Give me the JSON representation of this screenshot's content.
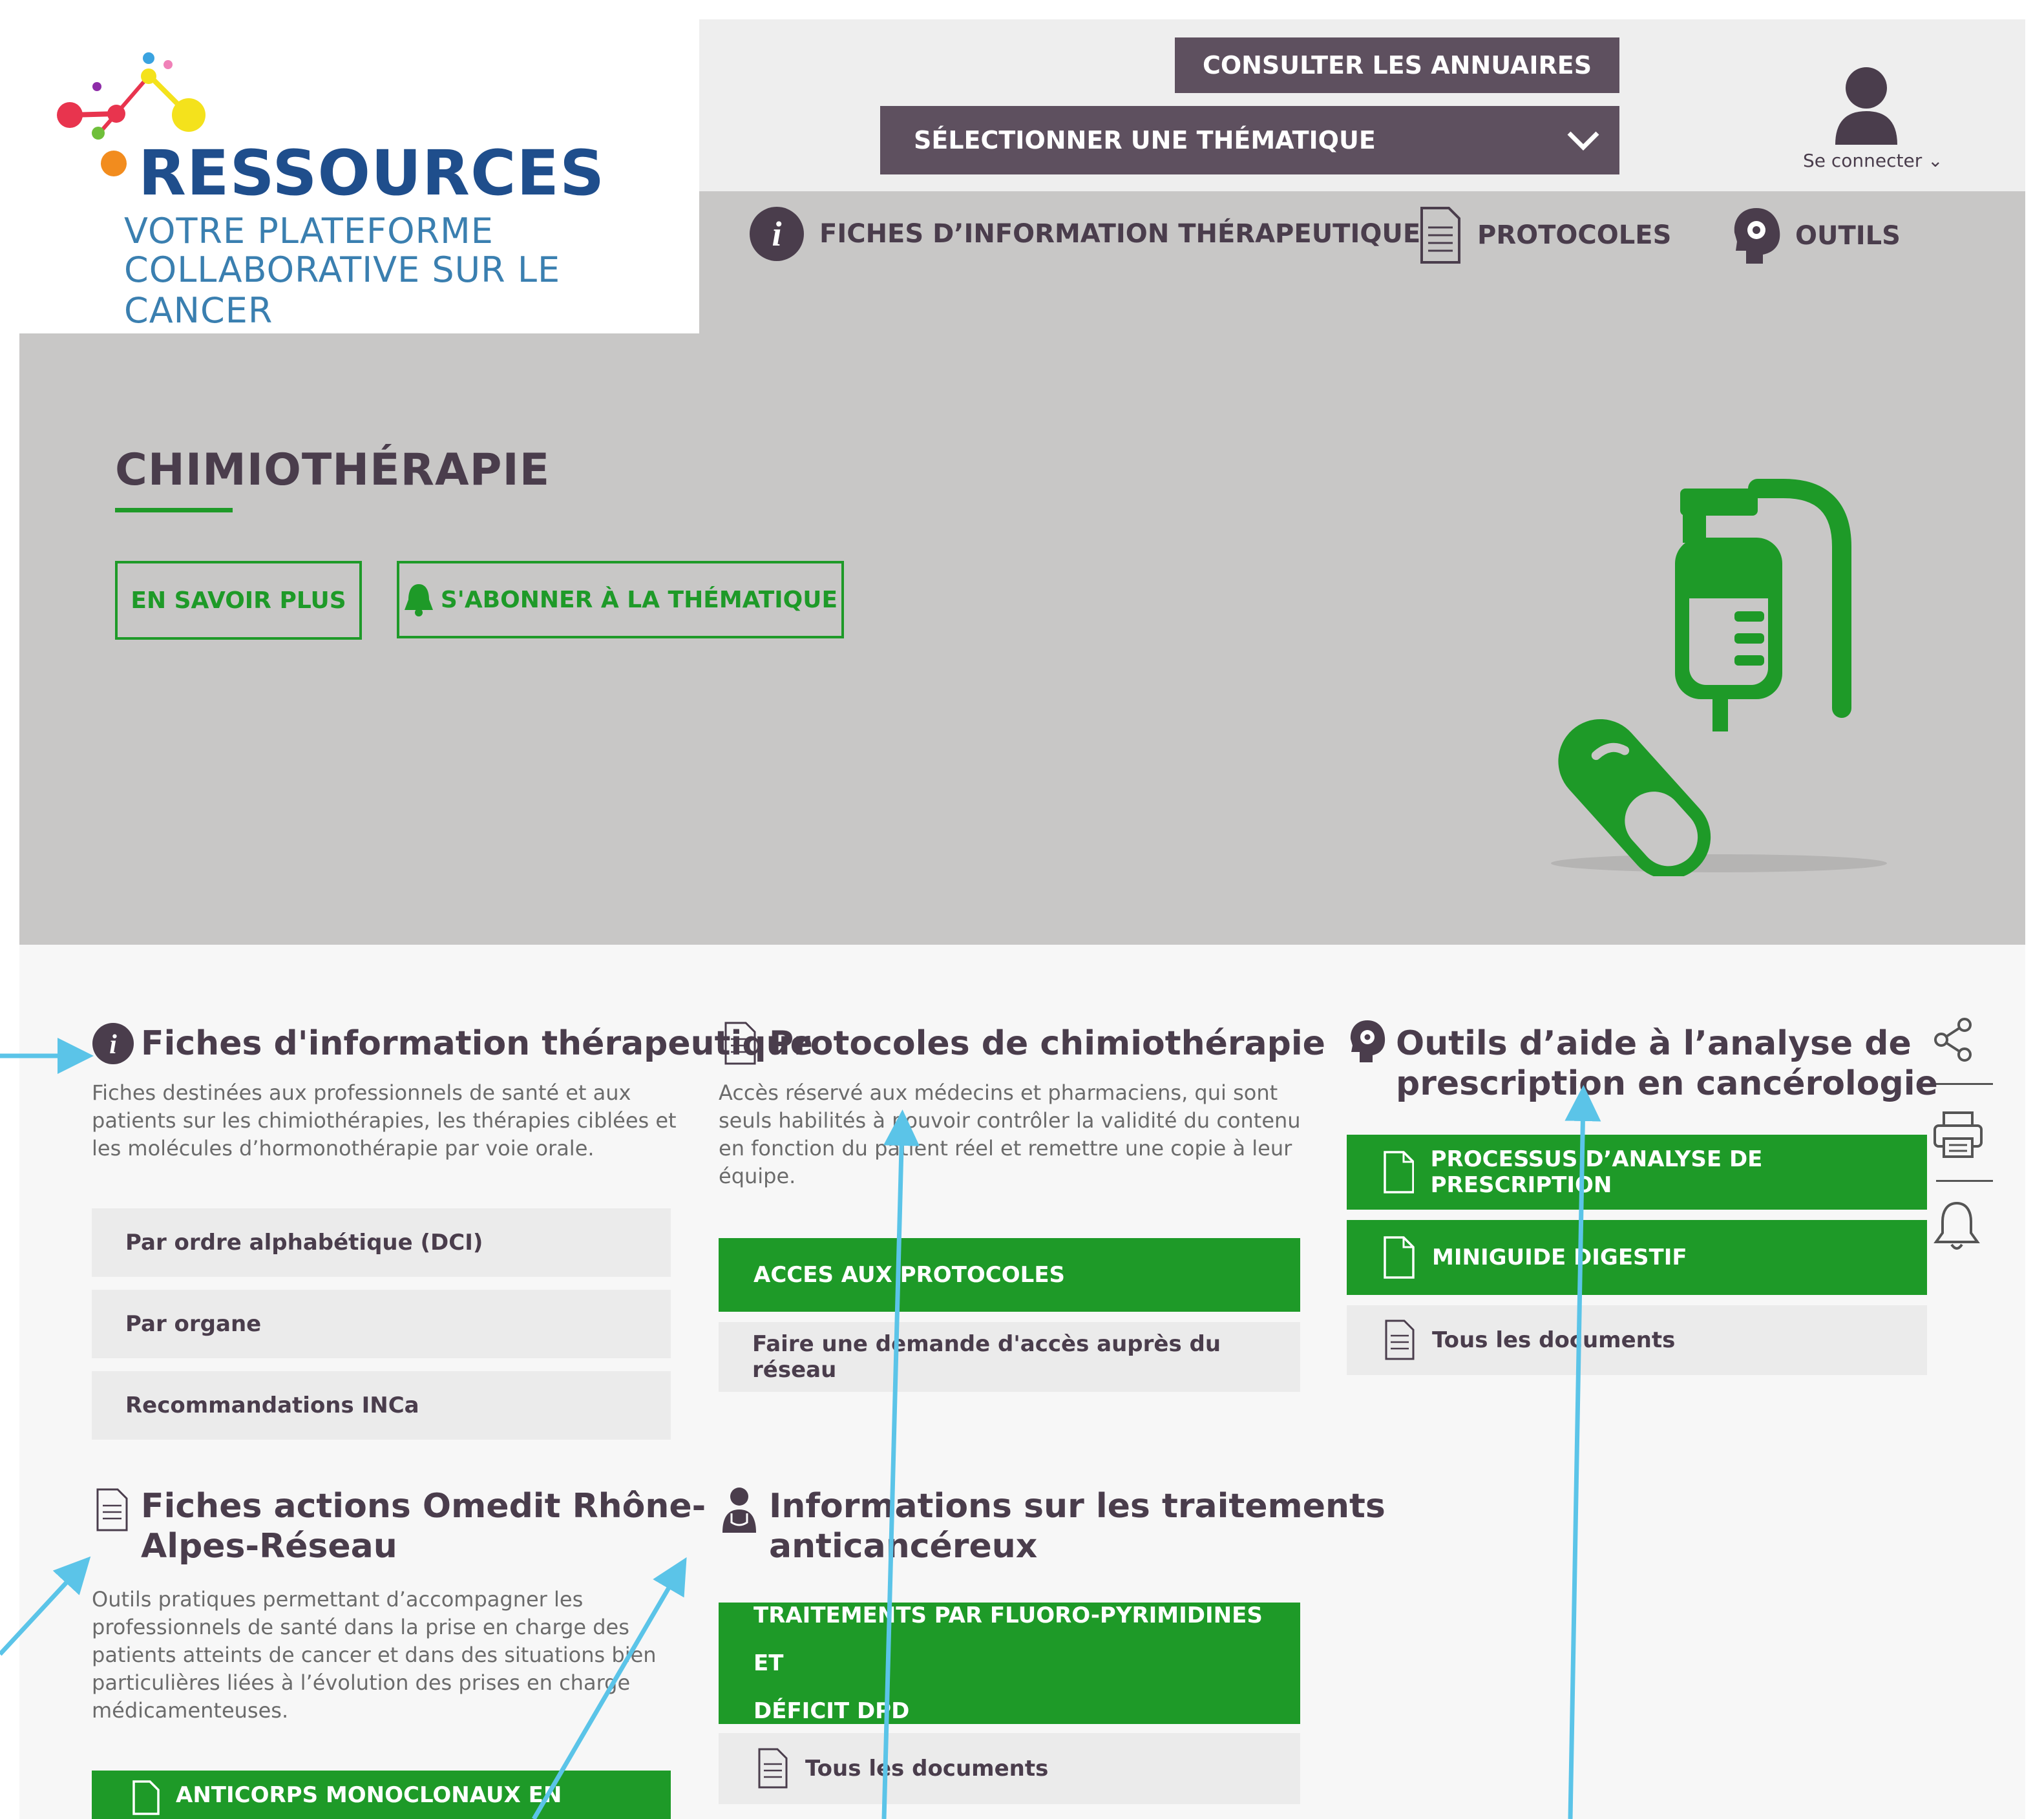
{
  "logo": {
    "name": "RESSOURCES",
    "tagline_1": "VOTRE PLATEFORME",
    "tagline_2": "COLLABORATIVE SUR LE CANCER"
  },
  "header": {
    "annuaires_label": "CONSULTER LES ANNUAIRES",
    "thematique_select": "SÉLECTIONNER UNE THÉMATIQUE",
    "login_label": "Se connecter",
    "nav": [
      {
        "label": "FICHES D’INFORMATION THÉRAPEUTIQUE",
        "icon": "info-icon"
      },
      {
        "label": "PROTOCOLES",
        "icon": "document-icon"
      },
      {
        "label": "OUTILS",
        "icon": "brain-gear-icon"
      }
    ]
  },
  "hero": {
    "title": "CHIMIOTHÉRAPIE",
    "more_button": "EN SAVOIR PLUS",
    "subscribe_button": "S'ABONNER À LA THÉMATIQUE",
    "illustration": "pill-and-iv-bag-icon"
  },
  "sections": {
    "fiches_info": {
      "title": "Fiches d'information thérapeutique",
      "description_lines": [
        "Fiches destinées aux professionnels de santé et aux",
        "patients sur les chimiothérapies, les thérapies ciblées et",
        "les molécules d’hormonothérapie par voie orale."
      ],
      "links": [
        "Par ordre alphabétique (DCI)",
        "Par organe",
        "Recommandations INCa"
      ]
    },
    "protocoles": {
      "title": "Protocoles de chimiothérapie",
      "description_lines": [
        "Accès réservé aux médecins et pharmaciens, qui sont",
        "seuls habilités à pouvoir contrôler la validité du contenu",
        "en fonction du patient réel et remettre une copie à leur",
        "équipe."
      ],
      "primary": "ACCES AUX PROTOCOLES",
      "secondary": "Faire une demande d'accès auprès du réseau"
    },
    "outils": {
      "title_lines": [
        "Outils d’aide à l’analyse de",
        "prescription en cancérologie"
      ],
      "doc_1": "PROCESSUS D’ANALYSE DE PRESCRIPTION",
      "doc_2": "MINIGUIDE DIGESTIF",
      "all_docs": "Tous les documents"
    },
    "omedit": {
      "title_lines": [
        "Fiches actions Omedit Rhône-",
        "Alpes-Réseau"
      ],
      "description_lines": [
        "Outils pratiques permettant d’accompagner les",
        "professionnels de santé dans la prise en charge des",
        "patients atteints de cancer et dans des situations bien",
        "particulières liées à l’évolution des prises en charge",
        "médicamenteuses."
      ],
      "doc_1": "ANTICORPS MONOCLONAUX EN"
    },
    "traitements": {
      "title_lines": [
        "Informations sur les traitements",
        "anticancéreux"
      ],
      "doc_1_lines": [
        "TRAITEMENTS PAR FLUORO-PYRIMIDINES ET",
        "DÉFICIT DPD"
      ],
      "all_docs": "Tous les documents"
    }
  },
  "side_tools": [
    "share-icon",
    "print-icon",
    "bell-icon"
  ],
  "colors": {
    "brand_green": "#1e9a28",
    "header_purple": "#5e505f",
    "hero_grey": "#c8c7c6",
    "annotation_blue": "#5bc4e8"
  }
}
